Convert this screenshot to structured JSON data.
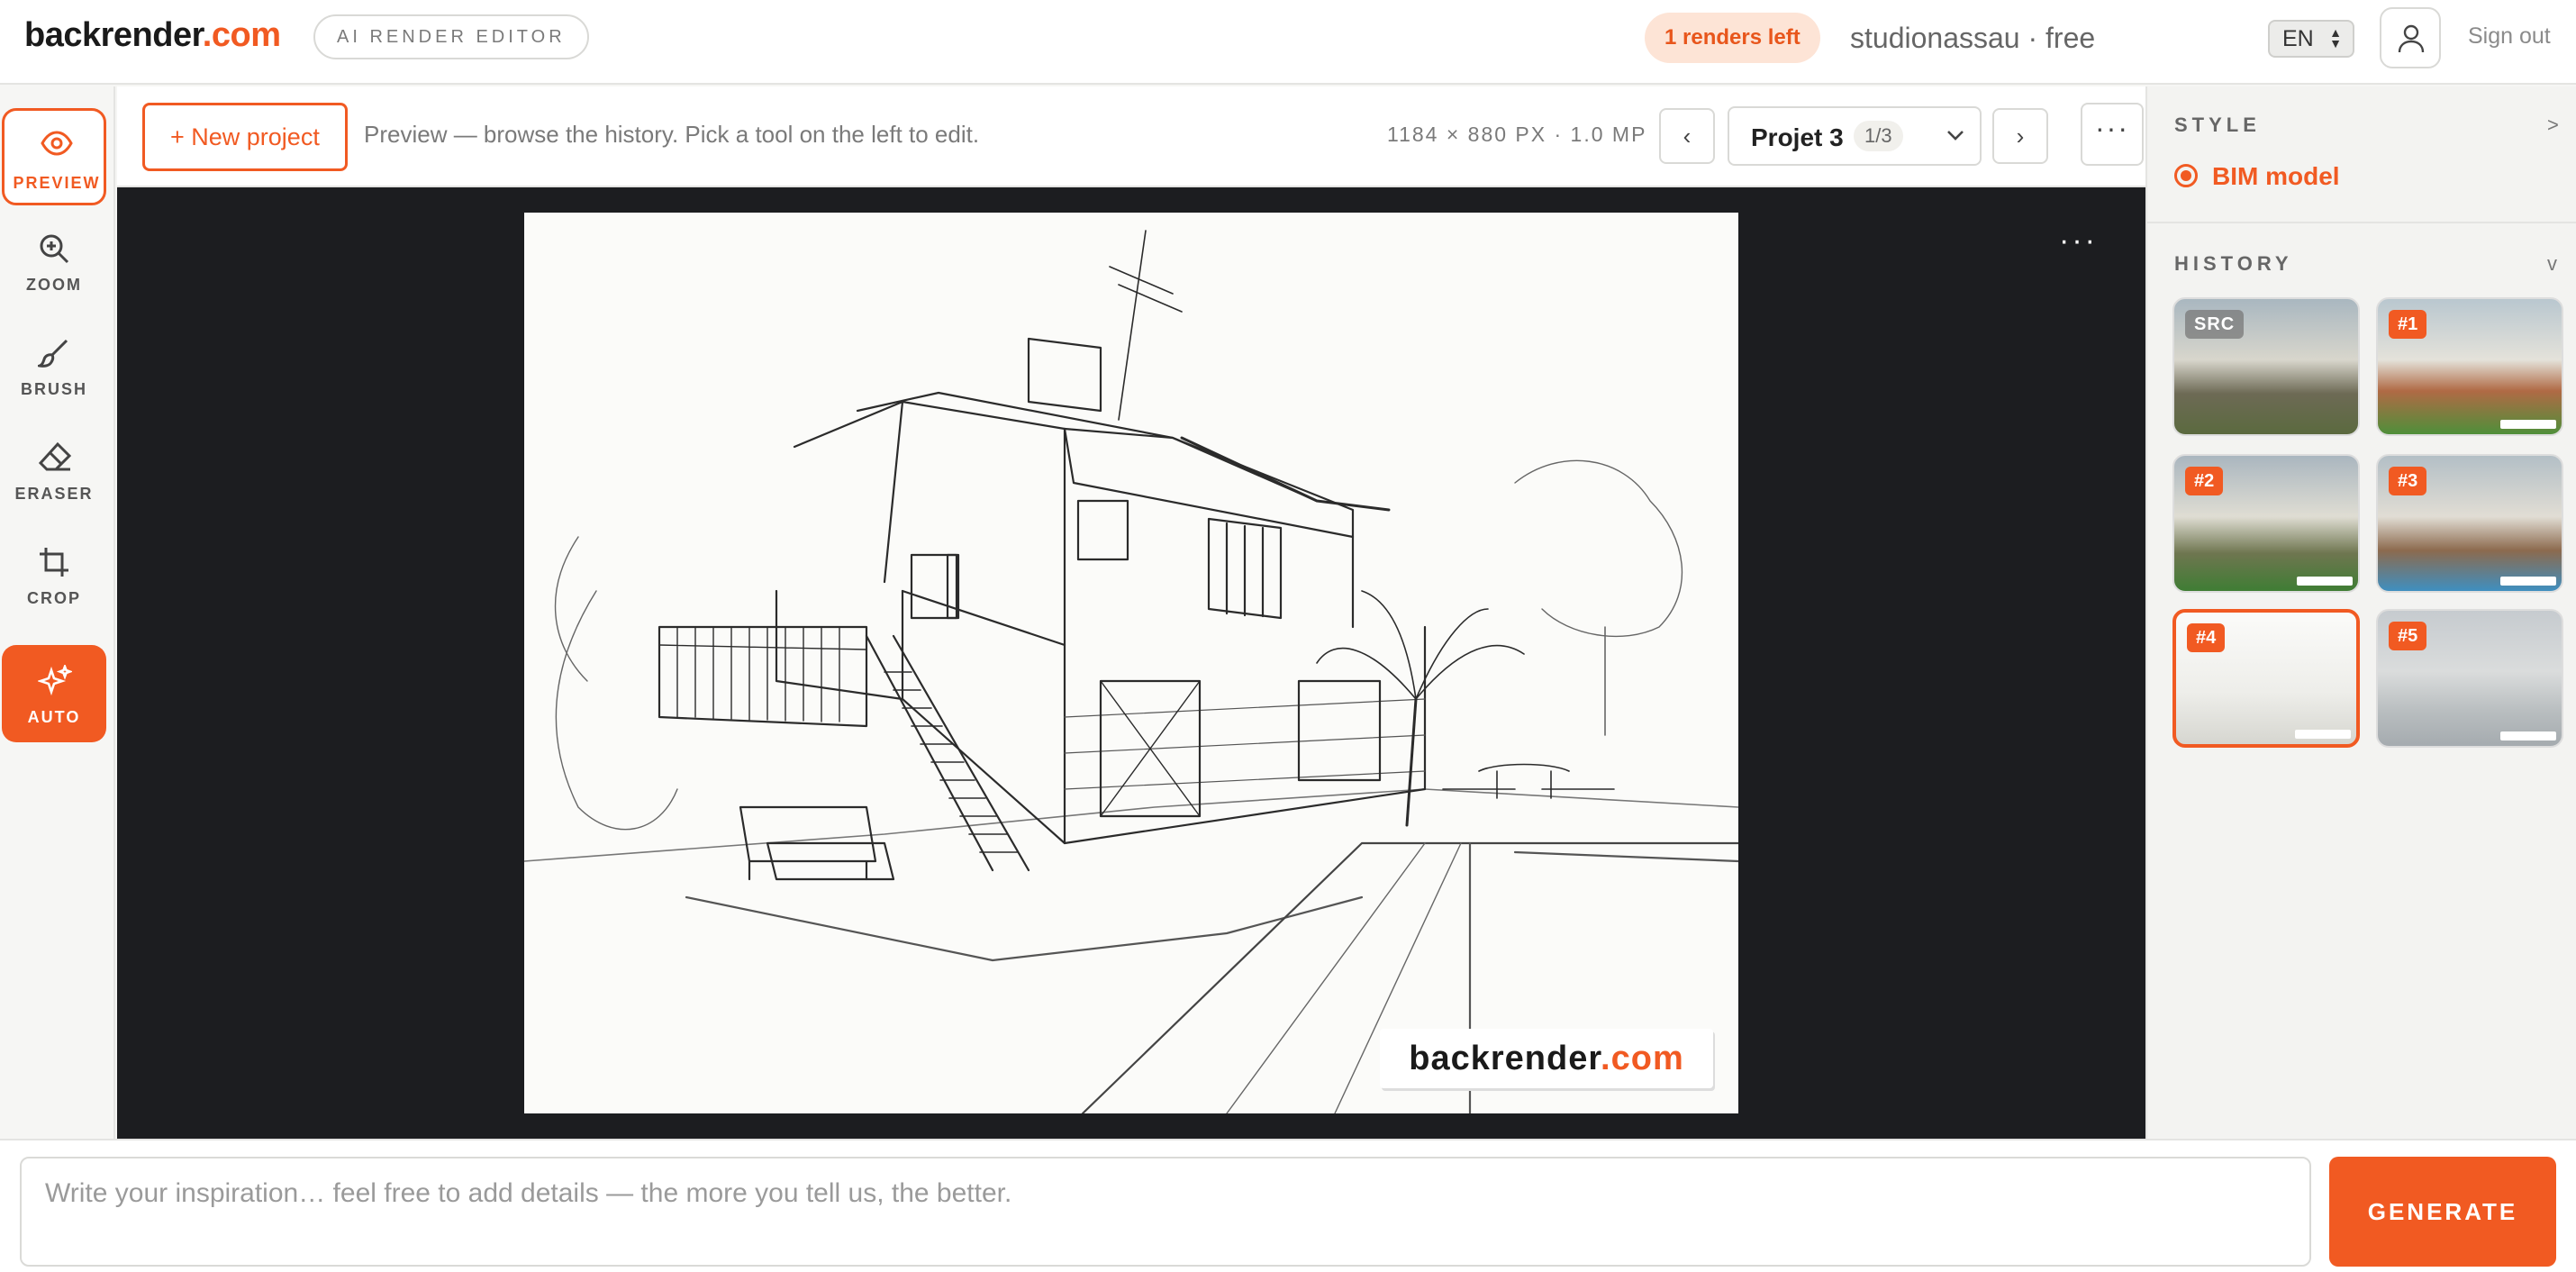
{
  "app": {
    "logo_main": "backrender",
    "logo_tld": ".com",
    "editor_label": "AI RENDER EDITOR",
    "renders_left": "1 renders left",
    "account": "studionassau · free",
    "language": "EN",
    "sign_out": "Sign out",
    "accent_color": "#f15a22"
  },
  "tools": [
    {
      "label": "PREVIEW",
      "icon": "eye-icon",
      "active": true
    },
    {
      "label": "ZOOM",
      "icon": "zoom-in-icon",
      "active": false
    },
    {
      "label": "BRUSH",
      "icon": "brush-icon",
      "active": false
    },
    {
      "label": "ERASER",
      "icon": "eraser-icon",
      "active": false
    },
    {
      "label": "CROP",
      "icon": "crop-icon",
      "active": false
    },
    {
      "label": "AUTO",
      "icon": "sparkles-icon",
      "active": false
    }
  ],
  "toolbar": {
    "new_project": "+ New project",
    "hint": "Preview — browse the history. Pick a tool on the left to edit.",
    "dimensions": "1184 × 880 PX · 1.0 MP",
    "prev": "‹",
    "next": "›",
    "project_name": "Projet 3",
    "project_count": "1/3",
    "more": "···"
  },
  "canvas": {
    "more": "···",
    "watermark_main": "backrender",
    "watermark_tld": ".com"
  },
  "style": {
    "title": "STYLE",
    "arrow": ">",
    "selected": "BIM model"
  },
  "history": {
    "title": "HISTORY",
    "arrow": "v",
    "items": [
      {
        "tag": "SRC"
      },
      {
        "tag": "#1"
      },
      {
        "tag": "#2"
      },
      {
        "tag": "#3"
      },
      {
        "tag": "#4",
        "selected": true
      },
      {
        "tag": "#5"
      }
    ]
  },
  "prompt": {
    "placeholder": "Write your inspiration… feel free to add details — the more you tell us, the better.",
    "generate": "GENERATE"
  }
}
